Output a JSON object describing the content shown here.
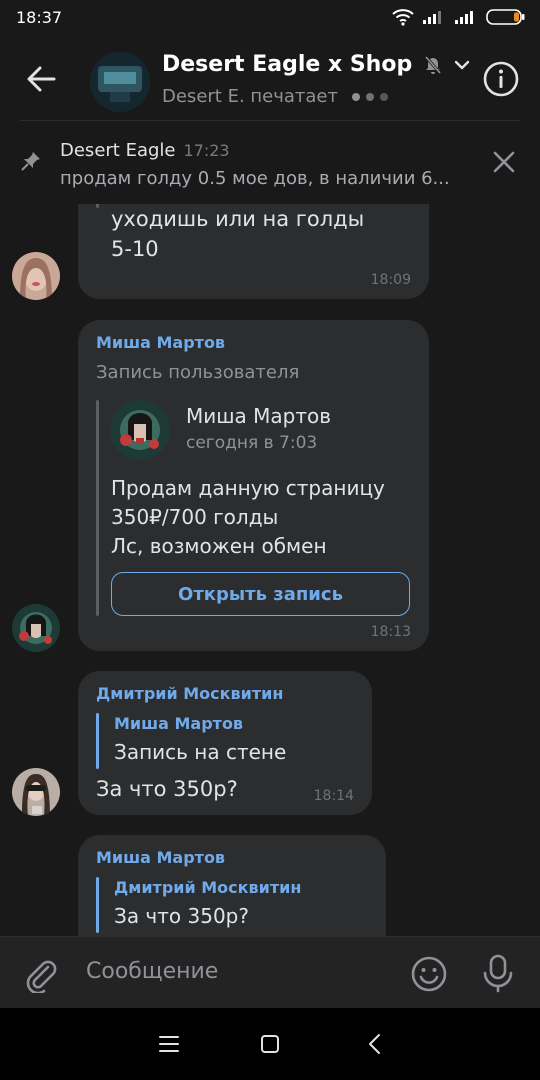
{
  "status_bar": {
    "time": "18:37",
    "icons": [
      "wifi-icon",
      "signal-icon",
      "signal-icon",
      "battery-icon"
    ]
  },
  "header": {
    "chat_title": "Desert Eagle x Shop",
    "typing_status": "Desert E. печатает",
    "icons": [
      "back-arrow-icon",
      "muted-bell-icon",
      "chevron-down-icon",
      "info-icon"
    ],
    "accent_color": "#71aaeb"
  },
  "pinned": {
    "author": "Desert Eagle",
    "time": "17:23",
    "text": "продам голду 0.5 мое дов, в наличии 6..."
  },
  "messages": [
    {
      "lines": [
        "уходишь или на голды",
        "5-10"
      ],
      "time": "18:09"
    },
    {
      "sender": "Миша Мартов",
      "repost_label": "Запись пользователя",
      "post": {
        "author": "Миша Мартов",
        "date": "сегодня в 7:03",
        "lines": [
          "Продам данную страницу",
          "350₽/700 голды",
          "Лс, возможен обмен"
        ],
        "button": "Открыть запись"
      },
      "time": "18:13"
    },
    {
      "sender": "Дмитрий Москвитин",
      "reply": {
        "name": "Миша Мартов",
        "text": "Запись на стене"
      },
      "text": "За что 350р?",
      "time": "18:14"
    },
    {
      "sender": "Миша Мартов",
      "reply": {
        "name": "Дмитрий Москвитин",
        "text": "За что 350р?"
      }
    }
  ],
  "composer": {
    "placeholder": "Сообщение"
  }
}
